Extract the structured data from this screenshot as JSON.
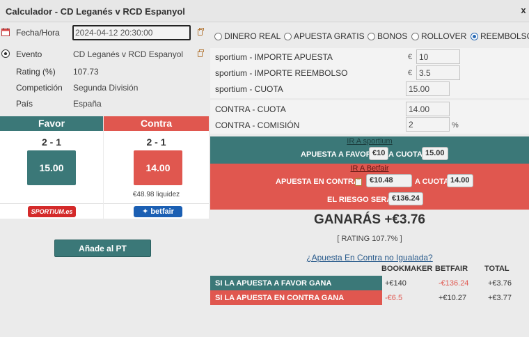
{
  "window": {
    "title": "Calculador - CD Leganés v RCD Espanyol",
    "close": "x"
  },
  "info": {
    "fecha": {
      "label": "Fecha/Hora",
      "value": "2024-04-12 20:30:00",
      "icon": "calendar-icon"
    },
    "evento": {
      "label": "Evento",
      "value": "CD Leganés v RCD Espanyol",
      "icon": "soccer-ball-icon"
    },
    "rating": {
      "label": "Rating (%)",
      "value": "107.73"
    },
    "competicion": {
      "label": "Competición",
      "value": "Segunda División"
    },
    "pais": {
      "label": "País",
      "value": "España"
    }
  },
  "favor": {
    "header": "Favor",
    "score": "2 - 1",
    "odds": "15.00",
    "bookmaker": "SPORTIUM.es",
    "color": "#3b7878"
  },
  "contra": {
    "header": "Contra",
    "score": "2 - 1",
    "odds": "14.00",
    "liquidity": "€48.98 liquidez",
    "exchange": "betfair",
    "color": "#e0574f"
  },
  "add_button": "Añade al PT",
  "modes": [
    {
      "label": "DINERO REAL",
      "selected": false
    },
    {
      "label": "APUESTA GRATIS",
      "selected": false
    },
    {
      "label": "BONOS",
      "selected": false
    },
    {
      "label": "ROLLOVER",
      "selected": false
    },
    {
      "label": "REEMBOLSO",
      "selected": true
    }
  ],
  "bookmaker_fields": {
    "stake": {
      "label": "sportium - IMPORTE APUESTA",
      "prefix": "€",
      "value": "10"
    },
    "refund": {
      "label": "sportium - IMPORTE REEMBOLSO",
      "prefix": "€",
      "value": "3.5"
    },
    "odds": {
      "label": "sportium - CUOTA",
      "value": "15.00"
    }
  },
  "exchange_fields": {
    "odds": {
      "label": "CONTRA - CUOTA",
      "value": "14.00"
    },
    "commission": {
      "label": "CONTRA - COMISIÓN",
      "value": "2",
      "suffix": "%"
    }
  },
  "favor_band": {
    "link": "IR A sportium",
    "text1": "APUESTA A FAVOR",
    "stake": "€10",
    "text2": "A CUOTA",
    "odds": "15.00"
  },
  "contra_band": {
    "link": "IR A Betfair",
    "text1": "APUESTA EN CONTRA",
    "stake": "€10.48",
    "text2": "A CUOTA",
    "odds": "14.00",
    "risk_label": "EL RIESGO SERÁ",
    "risk": "€136.24"
  },
  "result": {
    "label": "GANARÁS",
    "value": "+€3.76",
    "rating": "[ RATING 107.7% ]"
  },
  "unmatched_link": "¿Apuesta En Contra no Igualada?",
  "table": {
    "headers": [
      "BOOKMAKER",
      "BETFAIR",
      "TOTAL"
    ],
    "rows": [
      {
        "label": "SI LA APUESTA A FAVOR GANA",
        "bookmaker": "+€140",
        "betfair": "-€136.24",
        "total": "+€3.76"
      },
      {
        "label": "SI LA APUESTA EN CONTRA GANA",
        "bookmaker": "-€6.5",
        "betfair": "+€10.27",
        "total": "+€3.77"
      }
    ]
  },
  "colors": {
    "teal": "#3b7878",
    "red": "#e0574f",
    "negative": "#e0574f"
  }
}
